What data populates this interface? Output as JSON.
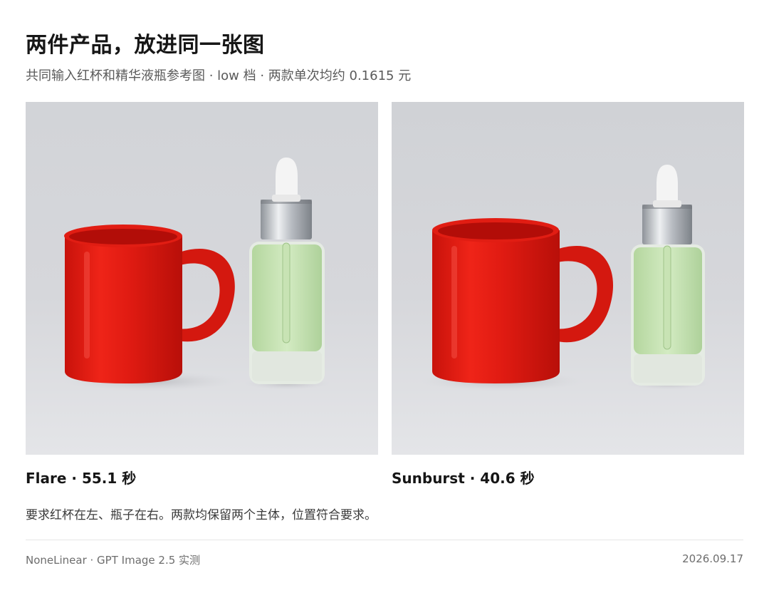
{
  "header": {
    "title": "两件产品，放进同一张图",
    "subtitle": "共同输入红杯和精华液瓶参考图 · low 档 · 两款单次均约 0.1615 元"
  },
  "results": [
    {
      "model": "Flare",
      "time_seconds": 55.1,
      "caption": "Flare · 55.1 秒"
    },
    {
      "model": "Sunburst",
      "time_seconds": 40.6,
      "caption": "Sunburst · 40.6 秒"
    }
  ],
  "note": "要求红杯在左、瓶子在右。两款均保留两个主体，位置符合要求。",
  "footer": {
    "source": "NoneLinear · GPT Image 2.5 实测",
    "date": "2026.09.17"
  },
  "colors": {
    "mug_red": "#e01b12",
    "serum_green": "#c8e2b5",
    "background_gray": "#d6d7db",
    "cap_silver": "#b8bcc2"
  }
}
